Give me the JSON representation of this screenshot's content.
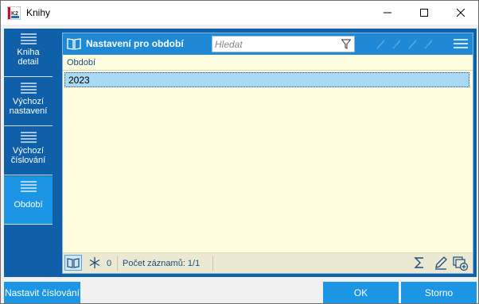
{
  "window": {
    "title": "Knihy"
  },
  "sidebar": {
    "items": [
      {
        "label_1": "Kniha",
        "label_2": "detail"
      },
      {
        "label_1": "Výchozí",
        "label_2": "nastavení"
      },
      {
        "label_1": "Výchozí",
        "label_2": "číslování"
      },
      {
        "label_1": "Období",
        "label_2": ""
      }
    ],
    "active": "Období"
  },
  "panel": {
    "title": "Nastavení pro období",
    "search": {
      "placeholder": "Hledat",
      "value": ""
    },
    "columns": [
      "Období"
    ],
    "rows": [
      {
        "obdobi": "2023"
      }
    ],
    "footer": {
      "selected_count": "0",
      "records_label": "Počet záznamů: 1/1"
    }
  },
  "buttons": {
    "set_numbering": "Nastavit číslování",
    "ok": "OK",
    "cancel": "Storno"
  },
  "colors": {
    "sidebar": "#0f60a8",
    "active": "#1c96e4",
    "panel_bg": "#fffde0",
    "selected_row": "#a9d9f3"
  },
  "icons": {
    "titlebar": [
      "app-icon",
      "minimize-icon",
      "maximize-icon",
      "close-icon"
    ],
    "panel": [
      "book-icon",
      "filter-icon",
      "menu-icon"
    ],
    "footer": [
      "book-icon",
      "snowflake-icon",
      "sum-icon",
      "edit-icon",
      "add-record-icon"
    ]
  }
}
